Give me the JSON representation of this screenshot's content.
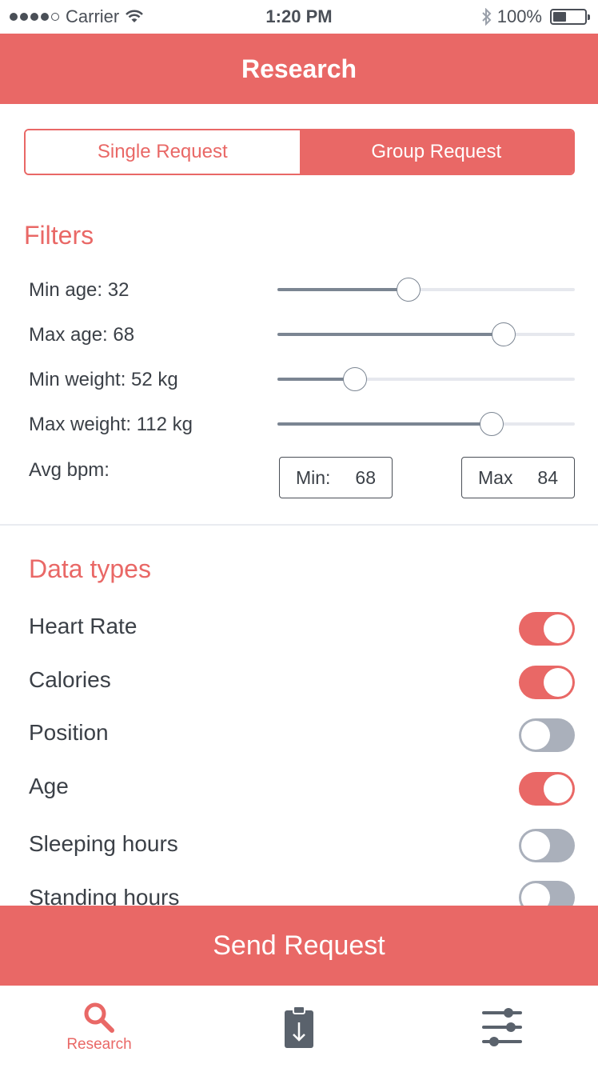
{
  "status_bar": {
    "carrier": "Carrier",
    "time": "1:20 PM",
    "battery": "100%",
    "signal_icon": "signal-dots-icon",
    "wifi_icon": "wifi-icon",
    "bluetooth_icon": "bluetooth-icon",
    "battery_icon": "battery-icon"
  },
  "nav": {
    "title": "Research"
  },
  "segmented": {
    "single": "Single Request",
    "group": "Group Request",
    "selected": "Group Request"
  },
  "filters": {
    "title": "Filters",
    "min_age": {
      "label": "Min age: 32",
      "value": 32,
      "fraction": 0.44
    },
    "max_age": {
      "label": "Max age: 68",
      "value": 68,
      "fraction": 0.76
    },
    "min_weight": {
      "label": "Min weight: 52 kg",
      "value": 52,
      "fraction": 0.26
    },
    "max_weight": {
      "label": "Max weight: 112 kg",
      "value": 112,
      "fraction": 0.72
    },
    "avg_bpm": {
      "label": "Avg bpm:",
      "min_label": "Min:",
      "min_value": "68",
      "max_label": "Max",
      "max_value": "84"
    }
  },
  "data_types": {
    "title": "Data types",
    "items": [
      {
        "label": "Heart Rate",
        "enabled": true
      },
      {
        "label": "Calories",
        "enabled": true
      },
      {
        "label": "Position",
        "enabled": false
      },
      {
        "label": "Age",
        "enabled": true
      },
      {
        "label": "Sleeping hours",
        "enabled": false
      },
      {
        "label": "Standing hours",
        "enabled": false
      }
    ]
  },
  "send_button": {
    "label": "Send Request"
  },
  "tab_bar": {
    "tabs": [
      {
        "label": "Research",
        "icon": "search-icon",
        "active": true
      },
      {
        "label": "",
        "icon": "clipboard-download-icon",
        "active": false
      },
      {
        "label": "",
        "icon": "sliders-icon",
        "active": false
      }
    ]
  },
  "colors": {
    "accent": "#e96866",
    "text": "#3b4047",
    "slider_fill": "#7b8592",
    "slider_track": "#e6e8ee",
    "toggle_off": "#aab0bb"
  }
}
